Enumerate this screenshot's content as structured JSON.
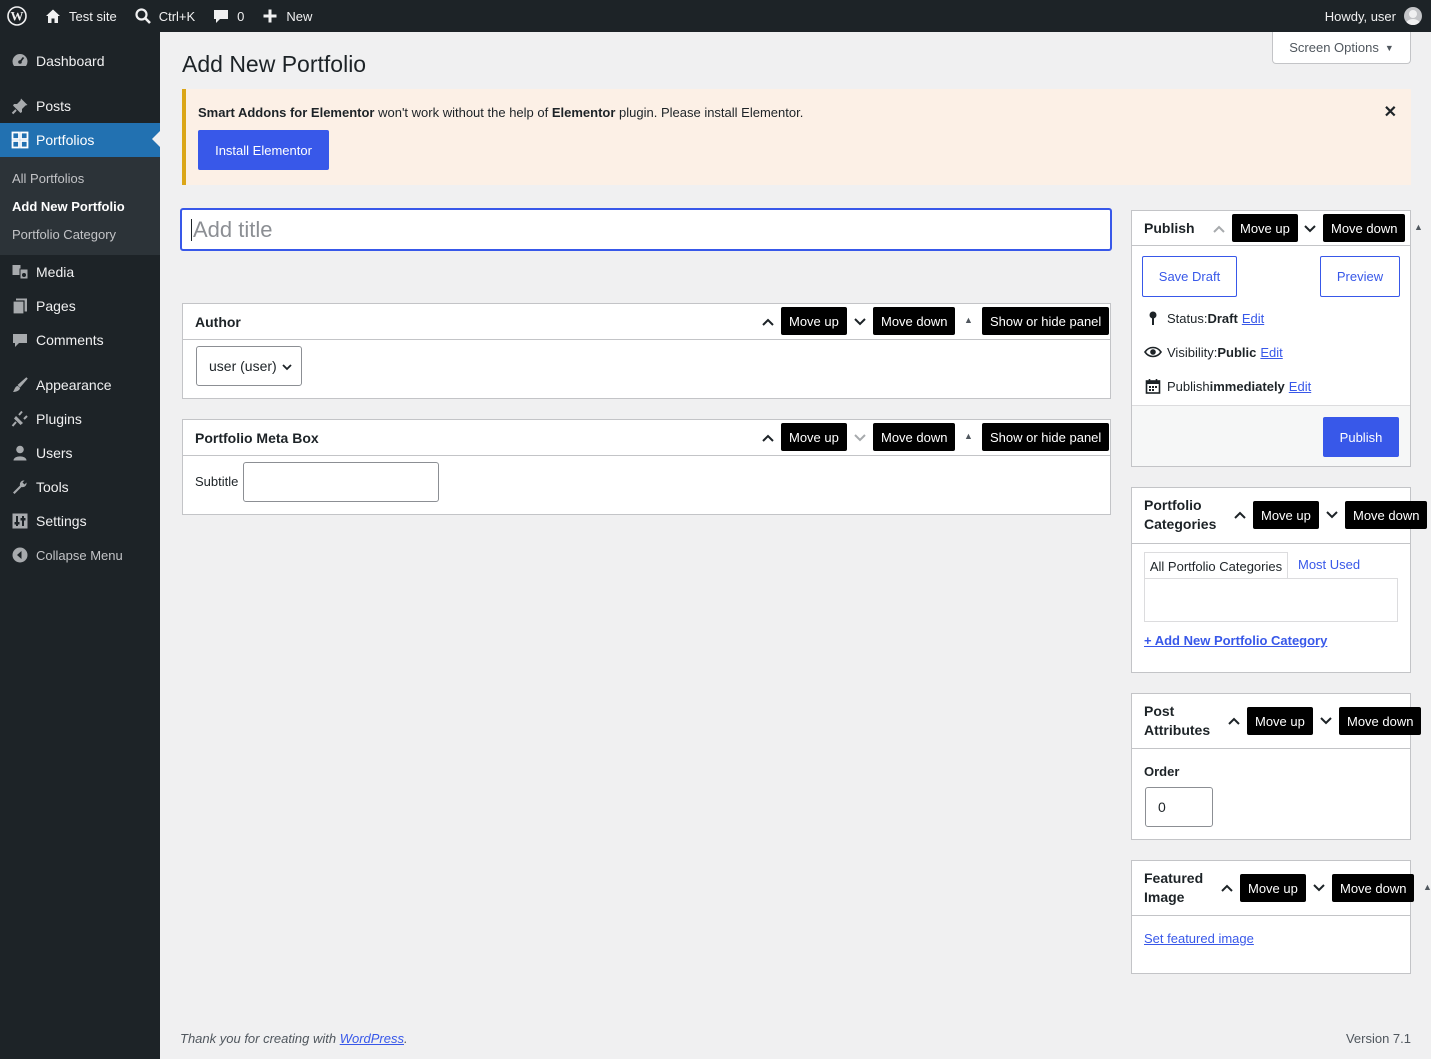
{
  "adminbar": {
    "site_name": "Test site",
    "search_shortcut": "Ctrl+K",
    "comments_count": "0",
    "new_label": "New",
    "howdy": "Howdy, user"
  },
  "sidebar": {
    "items": [
      {
        "label": "Dashboard",
        "icon": "dashboard-icon"
      },
      {
        "label": "Posts",
        "icon": "pin-icon"
      },
      {
        "label": "Portfolios",
        "icon": "grid-icon"
      },
      {
        "label": "Media",
        "icon": "media-icon"
      },
      {
        "label": "Pages",
        "icon": "pages-icon"
      },
      {
        "label": "Comments",
        "icon": "comment-icon"
      },
      {
        "label": "Appearance",
        "icon": "brush-icon"
      },
      {
        "label": "Plugins",
        "icon": "plug-icon"
      },
      {
        "label": "Users",
        "icon": "user-icon"
      },
      {
        "label": "Tools",
        "icon": "wrench-icon"
      },
      {
        "label": "Settings",
        "icon": "settings-icon"
      }
    ],
    "submenu": [
      "All Portfolios",
      "Add New Portfolio",
      "Portfolio Category"
    ],
    "collapse": "Collapse Menu"
  },
  "page": {
    "title": "Add New Portfolio",
    "screen_options": "Screen Options",
    "title_placeholder": "Add title"
  },
  "notice": {
    "plugin": "Smart Addons for Elementor",
    "text1": " won't work without the help of ",
    "dependency": "Elementor",
    "text2": " plugin. Please install Elementor.",
    "button": "Install Elementor"
  },
  "tooltips": {
    "move_up": "Move up",
    "move_down": "Move down",
    "show_hide": "Show or hide panel"
  },
  "author_box": {
    "title": "Author",
    "selected": "user (user)"
  },
  "meta_box": {
    "title": "Portfolio Meta Box",
    "subtitle_label": "Subtitle",
    "subtitle_value": ""
  },
  "publish": {
    "title": "Publish",
    "save_draft": "Save Draft",
    "preview": "Preview",
    "status_label": "Status: ",
    "status_value": "Draft",
    "visibility_label": "Visibility: ",
    "visibility_value": "Public",
    "publish_label": "Publish ",
    "publish_value": "immediately",
    "edit": "Edit",
    "publish_button": "Publish"
  },
  "categories": {
    "title_line1": "Portfolio",
    "title_line2": "Categories",
    "tab_all": "All Portfolio Categories",
    "tab_used": "Most Used",
    "add_new": "+ Add New Portfolio Category"
  },
  "attributes": {
    "title_line1": "Post",
    "title_line2": "Attributes",
    "order_label": "Order",
    "order_value": "0"
  },
  "featured": {
    "title_line1": "Featured",
    "title_line2": "Image",
    "set_link": "Set featured image"
  },
  "footer": {
    "thanks": "Thank you for creating with ",
    "wp_link": "WordPress",
    "period": ".",
    "version": "Version 7.1"
  },
  "colors": {
    "accent": "#3858e9",
    "menu_current": "#2271b1",
    "notice_border": "#dba617"
  }
}
